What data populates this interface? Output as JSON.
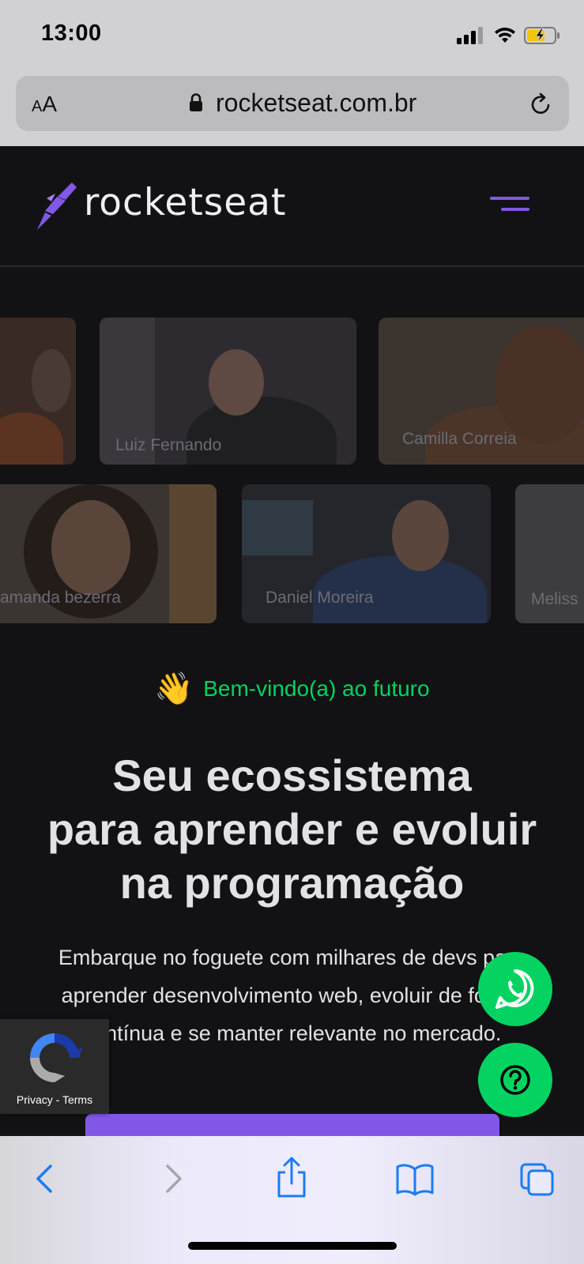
{
  "status_bar": {
    "time": "13:00"
  },
  "browser": {
    "text_size_label_small": "A",
    "text_size_label_large": "A",
    "url": "rocketseat.com.br"
  },
  "site": {
    "logo_text": "rocketseat",
    "students": [
      {
        "name": "Luiz Fernando"
      },
      {
        "name": "Camilla Correia"
      },
      {
        "name": "amanda bezerra"
      },
      {
        "name": "Daniel Moreira"
      },
      {
        "name": "Meliss"
      }
    ],
    "welcome": "Bem-vindo(a) ao futuro",
    "welcome_emoji": "👋",
    "headline_line1": "Seu ecossistema",
    "headline_line2": "para aprender e evoluir",
    "headline_line3": "na programação",
    "subtitle_line1": "Embarque no foguete com milhares de devs para",
    "subtitle_line2": "aprender desenvolvimento web, evoluir de forma",
    "subtitle_line3": "contínua e se manter relevante no mercado."
  },
  "recaptcha": {
    "privacy": "Privacy",
    "separator": " - ",
    "terms": "Terms"
  },
  "colors": {
    "accent": "#8257e5",
    "green": "#04d361",
    "background": "#121214"
  }
}
